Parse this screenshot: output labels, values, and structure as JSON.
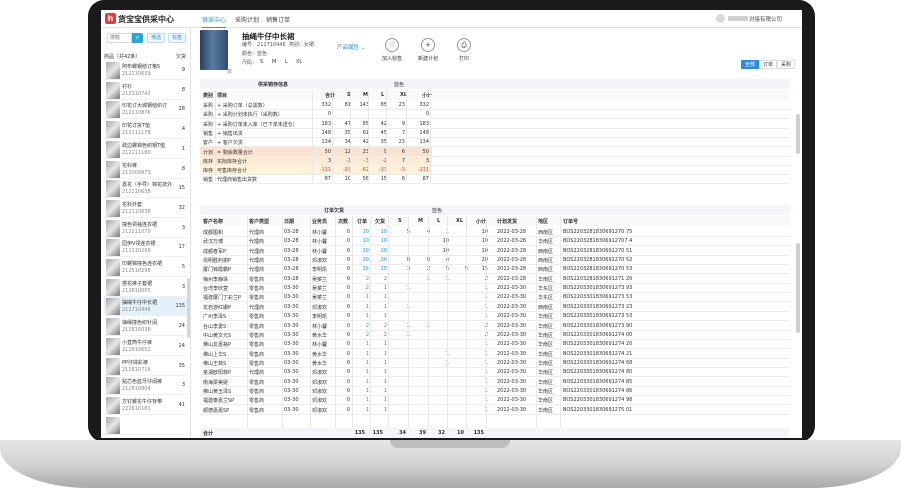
{
  "app": {
    "title": "货宝宝供采中心",
    "logo_char": "h",
    "nav": [
      "供采中心",
      "采购计划",
      "销售订单"
    ],
    "user": "对接有限公司"
  },
  "sidebar": {
    "search_placeholder": "搜款",
    "search_btn": "搜",
    "btn_filter": "筛选",
    "btn_tag": "标签",
    "list_title": "商品（共42条）",
    "list_stock": "欠货",
    "items": [
      {
        "name": "阿布螺钢结订格5",
        "code": "212110639",
        "count": "9"
      },
      {
        "name": "衬衫",
        "code": "212110742",
        "count": "8"
      },
      {
        "name": "印花订大城钢结织订",
        "code": "212110876",
        "count": "28"
      },
      {
        "name": "印花订拆T恤",
        "code": "212111178",
        "count": "4"
      },
      {
        "name": "疏边螺锦色织钢T恤",
        "code": "212111180",
        "count": "1"
      },
      {
        "name": "花科裤",
        "code": "212009973",
        "count": "8"
      },
      {
        "name": "嘉花（手导）锦花技外",
        "code": "212110638",
        "count": "15"
      },
      {
        "name": "花科外套",
        "code": "212110638",
        "count": "32"
      },
      {
        "name": "撞色领袖连衣裙",
        "code": "212111079",
        "count": "3"
      },
      {
        "name": "园伊V领连衣裙",
        "code": "212110298",
        "count": "17"
      },
      {
        "name": "印螺锦撞色连衣裙",
        "code": "212510298",
        "count": "5"
      },
      {
        "name": "搭花裤子套裙",
        "code": "212610005",
        "count": "3"
      },
      {
        "name": "抽绳牛仔中长裙",
        "code": "212710446",
        "count": "135"
      },
      {
        "name": "抽绳撞色织针阔",
        "code": "212810036",
        "count": "24"
      },
      {
        "name": "小直筒牛仔裤",
        "code": "212810652",
        "count": "24"
      },
      {
        "name": "PP仔揉彩裤",
        "code": "212810718",
        "count": "35"
      },
      {
        "name": "贴芯色蓝牙仔阔裤",
        "code": "212810804",
        "count": "3"
      },
      {
        "name": "方钉螺花牛仔背带",
        "code": "222610181",
        "count": "41"
      },
      {
        "name": "",
        "code": "",
        "count": ""
      }
    ]
  },
  "product": {
    "name": "抽绳牛仔中长裙",
    "code_label": "编号：",
    "code": "212710446",
    "cat_label": "类别：",
    "cat": "女裙",
    "color_label": "颜色：",
    "color": "蓝色",
    "size_label": "尺码：",
    "sizes": [
      "S",
      "M",
      "L",
      "XL"
    ],
    "attr_link": "产品属性",
    "img_tag": "款"
  },
  "actions": [
    {
      "label": "加入标签",
      "icon": "♡"
    },
    {
      "label": "新建计划",
      "icon": "+"
    },
    {
      "label": "打印",
      "icon": "⎙"
    }
  ],
  "filters": [
    "全部",
    "订单",
    "采购"
  ],
  "inv": {
    "header": "供采销存信息",
    "color_header": "蓝色",
    "cols": [
      "类别",
      "项目",
      "合计",
      "S",
      "M",
      "L",
      "XL",
      "小计"
    ],
    "rows": [
      {
        "c": "采购",
        "i": "+ 采购订单（总需数）",
        "v": [
          "332",
          "81",
          "143",
          "85",
          "23",
          "332"
        ],
        "bg": ""
      },
      {
        "c": "采购",
        "i": "+ 采购计划未执行（采购数）",
        "v": [
          "0",
          "",
          "",
          "",
          "",
          "0"
        ],
        "bg": ""
      },
      {
        "c": "采购",
        "i": "+ 采购订单未入库（已下单未送仓）",
        "v": [
          "183",
          "47",
          "85",
          "42",
          "9",
          "183"
        ],
        "bg": ""
      },
      {
        "c": "销售",
        "i": "+ 销售出货",
        "v": [
          "148",
          "35",
          "61",
          "45",
          "7",
          "148"
        ],
        "bg": ""
      },
      {
        "c": "客户",
        "i": "+ 客户欠货",
        "v": [
          "134",
          "34",
          "42",
          "35",
          "23",
          "134"
        ],
        "bg": ""
      },
      {
        "c": "计划",
        "i": "= 剩余数量合计",
        "v": [
          "50",
          "12",
          "23",
          "9",
          "6",
          "50"
        ],
        "bg": "#fbe3d4"
      },
      {
        "c": "库存",
        "i": "实际库存合计",
        "v": [
          "3",
          "-1",
          "-3",
          "-2",
          "7",
          "3"
        ],
        "bg": "#fcebd6"
      },
      {
        "c": "库存",
        "i": "可售库存合计",
        "v": [
          "-131",
          "-33",
          "-62",
          "-33",
          "-3",
          "-131"
        ],
        "bg": "#fdf3d8"
      },
      {
        "c": "销售",
        "i": "代理商销售出货数",
        "v": [
          "87",
          "10",
          "56",
          "15",
          "6",
          "87"
        ],
        "bg": ""
      }
    ]
  },
  "orders": {
    "order_header": "订单欠货",
    "color_header": "蓝色",
    "cols": [
      "客户名称",
      "客户类型",
      "日期",
      "业务员",
      "次数",
      "订单",
      "欠货",
      "S",
      "M",
      "L",
      "XL",
      "小计",
      "计划发货",
      "地区",
      "订单号"
    ],
    "rows": [
      [
        "成都图和",
        "代理商",
        "03-28",
        "林小馨",
        "0",
        "10",
        "10",
        "5",
        "4",
        "1",
        "",
        "10",
        "2022-03-28",
        "西南区",
        "BOS2203281830691270 75"
      ],
      [
        "武汉万博",
        "代理商",
        "03-28",
        "林小馨",
        "0",
        "10",
        "10",
        "",
        "",
        "10",
        "",
        "10",
        "2022-03-28",
        "华南区",
        "BOS22032818306912707 4"
      ],
      [
        "成都春军P",
        "代理商",
        "03-28",
        "林小馨",
        "0",
        "20",
        "20",
        "",
        "",
        "10",
        "",
        "10",
        "2022-03-28",
        "西南区",
        "BOS2203281830691270 51"
      ],
      [
        "昆明胜利谢P",
        "代理商",
        "03-28",
        "邓淑欢",
        "0",
        "20",
        "20",
        "8",
        "8",
        "4",
        "",
        "20",
        "2022-03-28",
        "西南区",
        "BOS2203281830691270 52"
      ],
      [
        "厦门锦霞霸P",
        "代理商",
        "03-28",
        "李明凯",
        "0",
        "15",
        "15",
        "3",
        "2",
        "5",
        "5",
        "15",
        "2022-03-28",
        "西南区",
        "BOS2203281830691270 53"
      ],
      [
        "梅州李静珠",
        "零售商",
        "03-28",
        "吴菜兰",
        "0",
        "2",
        "2",
        "",
        "1",
        "1",
        "",
        "2",
        "2022-03-28",
        "华南区",
        "BOS2203281830691271 20"
      ],
      [
        "台湾李欣萱",
        "零售商",
        "03-30",
        "吴菜兰",
        "0",
        "2",
        "1",
        "1",
        "",
        "",
        "",
        "1",
        "2022-03-30",
        "华东区",
        "BOS2203301830691273 93"
      ],
      [
        "福建厦门丁彩兰P",
        "零售商",
        "03-30",
        "吴菜兰",
        "0",
        "1",
        "1",
        "",
        "",
        "",
        "",
        "1",
        "2022-03-30",
        "华东区",
        "BOS2203301830691273 53"
      ],
      [
        "龙岩游红娜P",
        "代理商",
        "03-30",
        "邓淑欢",
        "0",
        "1",
        "1",
        "1",
        "",
        "",
        "",
        "1",
        "2022-03-30",
        "西南区",
        "BOS2203301830691273 23"
      ],
      [
        "广州李泽S",
        "零售商",
        "03-30",
        "李明凯",
        "0",
        "1",
        "1",
        "",
        "",
        "",
        "",
        "1",
        "2022-03-30",
        "华南区",
        "BOS2203301830691273 53"
      ],
      [
        "台山李勇S",
        "零售商",
        "03-30",
        "林小馨",
        "0",
        "2",
        "2",
        "1",
        "1",
        "",
        "",
        "2",
        "2022-03-30",
        "华南区",
        "BOS2203301830691273 90"
      ],
      [
        "中山黄文元S",
        "零售商",
        "03-30",
        "黄水华",
        "0",
        "2",
        "2",
        "1",
        "",
        "",
        "",
        "2",
        "2022-03-30",
        "华南区",
        "BOS2203301830691274 00"
      ],
      [
        "佛山友嘉裕P",
        "零售商",
        "03-30",
        "林小馨",
        "0",
        "1",
        "1",
        "",
        "",
        "",
        "",
        "1",
        "2022-03-30",
        "华南区",
        "BOS2203301830691274 20"
      ],
      [
        "佛山上华S",
        "零售商",
        "03-30",
        "黄水华",
        "0",
        "1",
        "1",
        "",
        "",
        "1",
        "",
        "1",
        "2022-03-30",
        "华南区",
        "BOS2203301830691274 21"
      ],
      [
        "佛山王菲S",
        "零售商",
        "03-30",
        "黄水华",
        "0",
        "1",
        "1",
        "",
        "",
        "1",
        "",
        "1",
        "2022-03-30",
        "华南区",
        "BOS2203301830691274 68"
      ],
      [
        "芜湖欧阳菲P",
        "代理商",
        "03-30",
        "邓淑欢",
        "0",
        "1",
        "1",
        "",
        "",
        "",
        "",
        "1",
        "2022-03-30",
        "华南区",
        "BOS2203301830691274 80"
      ],
      [
        "南海梁美妮",
        "零售商",
        "03-30",
        "邓淑欢",
        "0",
        "1",
        "1",
        "",
        "",
        "",
        "",
        "1",
        "2022-03-30",
        "华南区",
        "BOS2203301830691274 85"
      ],
      [
        "佛山黄玉泽S",
        "零售商",
        "03-30",
        "邓淑欢",
        "0",
        "1",
        "1",
        "",
        "",
        "",
        "",
        "1",
        "2022-03-30",
        "华南区",
        "BOS2203301830691274 86"
      ],
      [
        "福建泰嘉兰SP",
        "零售商",
        "03-30",
        "邓淑欢",
        "0",
        "1",
        "1",
        "",
        "",
        "",
        "",
        "1",
        "2022-03-30",
        "华南区",
        "BOS2203301830691274 98"
      ],
      [
        "顺德嘉嘉SP",
        "零售商",
        "03-30",
        "邓淑欢",
        "0",
        "1",
        "1",
        "",
        "",
        "",
        "",
        "1",
        "2022-03-30",
        "华南区",
        "BOS2203301830691275 01"
      ]
    ],
    "total": {
      "label": "合计",
      "v": [
        "135",
        "135",
        "34",
        "39",
        "32",
        "10",
        "135"
      ]
    }
  }
}
